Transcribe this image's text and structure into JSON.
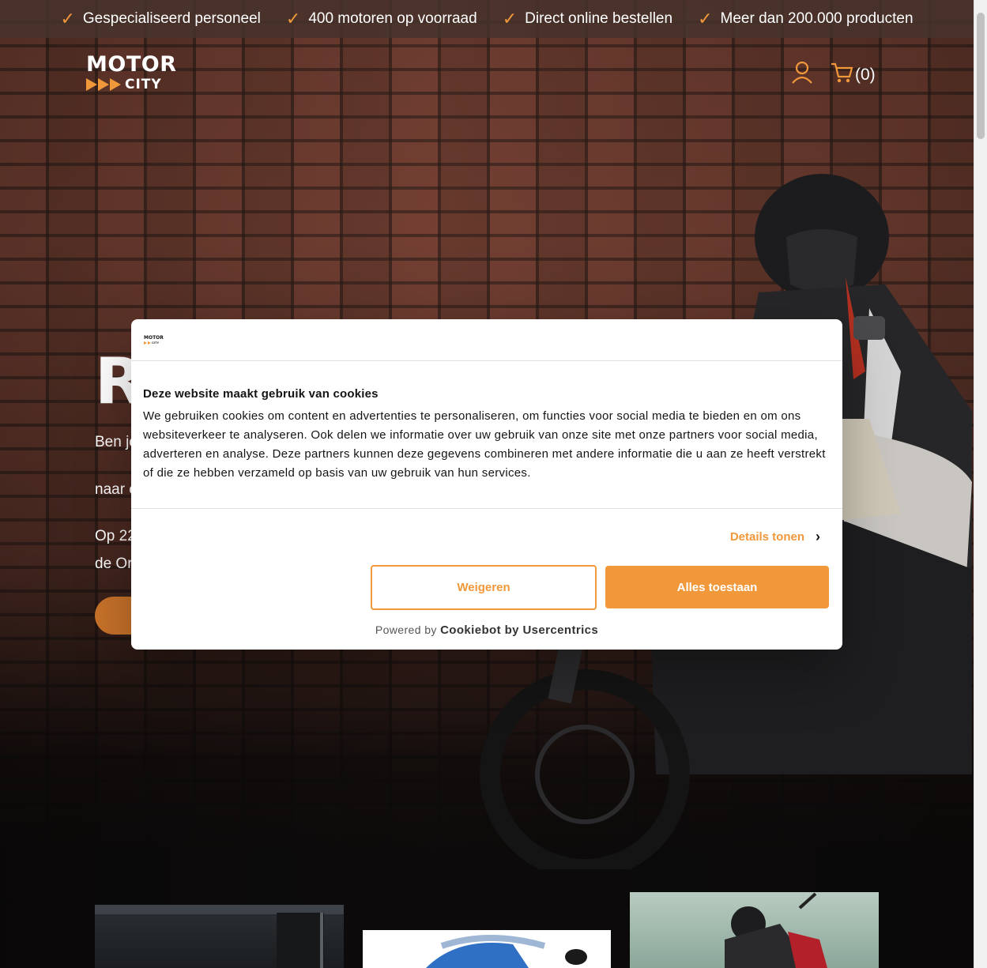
{
  "usp_bar": {
    "items": [
      {
        "label": "Gespecialiseerd personeel"
      },
      {
        "label": "400 motoren op voorraad"
      },
      {
        "label": "Direct online bestellen"
      },
      {
        "label": "Meer dan 200.000 producten"
      }
    ]
  },
  "header": {
    "logo_top": "MOTOR",
    "logo_bottom": "CITY",
    "cart_count": "(0)"
  },
  "hero": {
    "title_visible": "R",
    "line1_visible": "Ben je",
    "line2_visible": "naar e",
    "line3_visible": "Op 22",
    "line4_visible": "de Or"
  },
  "cookie_modal": {
    "mini_logo_top": "MOTOR",
    "mini_logo_bottom": "CITY",
    "title": "Deze website maakt gebruik van cookies",
    "text": "We gebruiken cookies om content en advertenties te personaliseren, om functies voor social media te bieden en om ons websiteverkeer te analyseren. Ook delen we informatie over uw gebruik van onze site met onze partners voor social media, adverteren en analyse. Deze partners kunnen deze gegevens combineren met andere informatie die u aan ze heeft verstrekt of die ze hebben verzameld op basis van uw gebruik van hun services.",
    "details_label": "Details tonen",
    "decline_label": "Weigeren",
    "accept_label": "Alles toestaan",
    "powered_prefix": "Powered by",
    "powered_brand": "Cookiebot by Usercentrics"
  },
  "colors": {
    "accent": "#f0983a",
    "text": "#141414"
  }
}
